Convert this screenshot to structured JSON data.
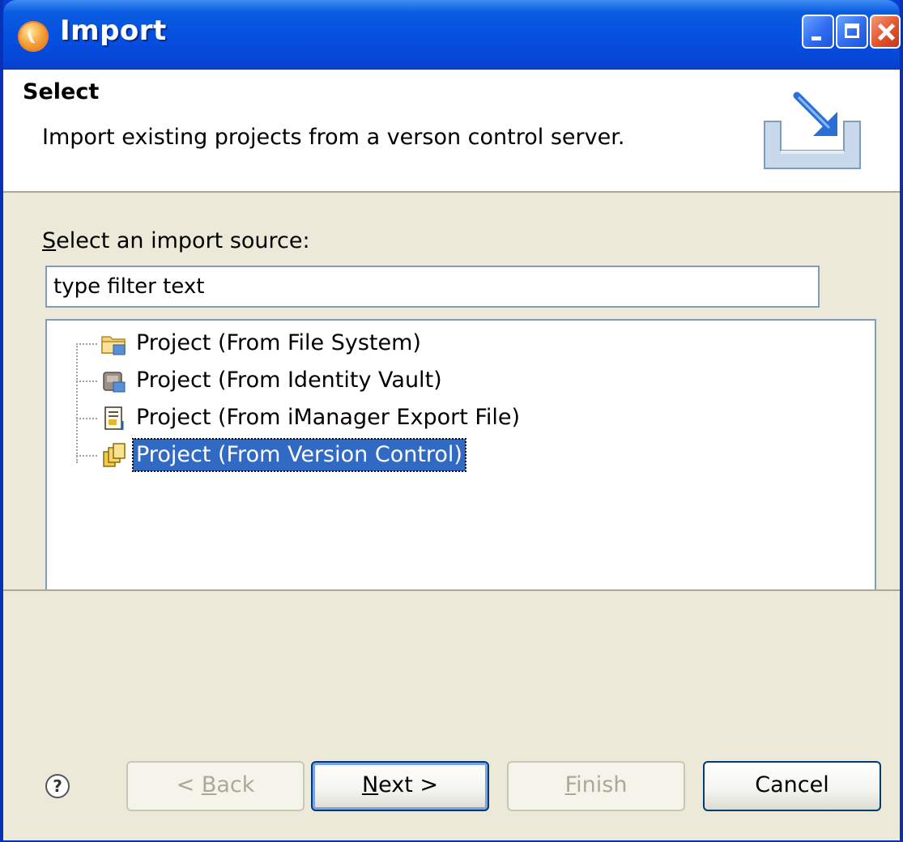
{
  "window": {
    "title": "Import"
  },
  "header": {
    "title": "Select",
    "description": "Import existing projects from a verson control server."
  },
  "source": {
    "label_mnemonic": "S",
    "label_rest": "elect an import source:",
    "filter_value": "type filter text"
  },
  "tree": {
    "items": [
      {
        "label": "Project (From File System)",
        "icon": "folder-project-icon",
        "selected": false
      },
      {
        "label": "Project (From Identity Vault)",
        "icon": "identity-vault-icon",
        "selected": false
      },
      {
        "label": "Project (From iManager Export File)",
        "icon": "export-file-icon",
        "selected": false
      },
      {
        "label": "Project (From Version Control)",
        "icon": "version-control-icon",
        "selected": true
      }
    ]
  },
  "buttons": {
    "back_prefix": "< ",
    "back_mnemonic": "B",
    "back_rest": "ack",
    "next_mnemonic": "N",
    "next_rest": "ext >",
    "finish_mnemonic": "F",
    "finish_rest": "inish",
    "cancel": "Cancel",
    "help": "?"
  },
  "colors": {
    "title_bar": "#0551e0",
    "selection": "#316ac5",
    "dialog_bg": "#ece9d8"
  }
}
